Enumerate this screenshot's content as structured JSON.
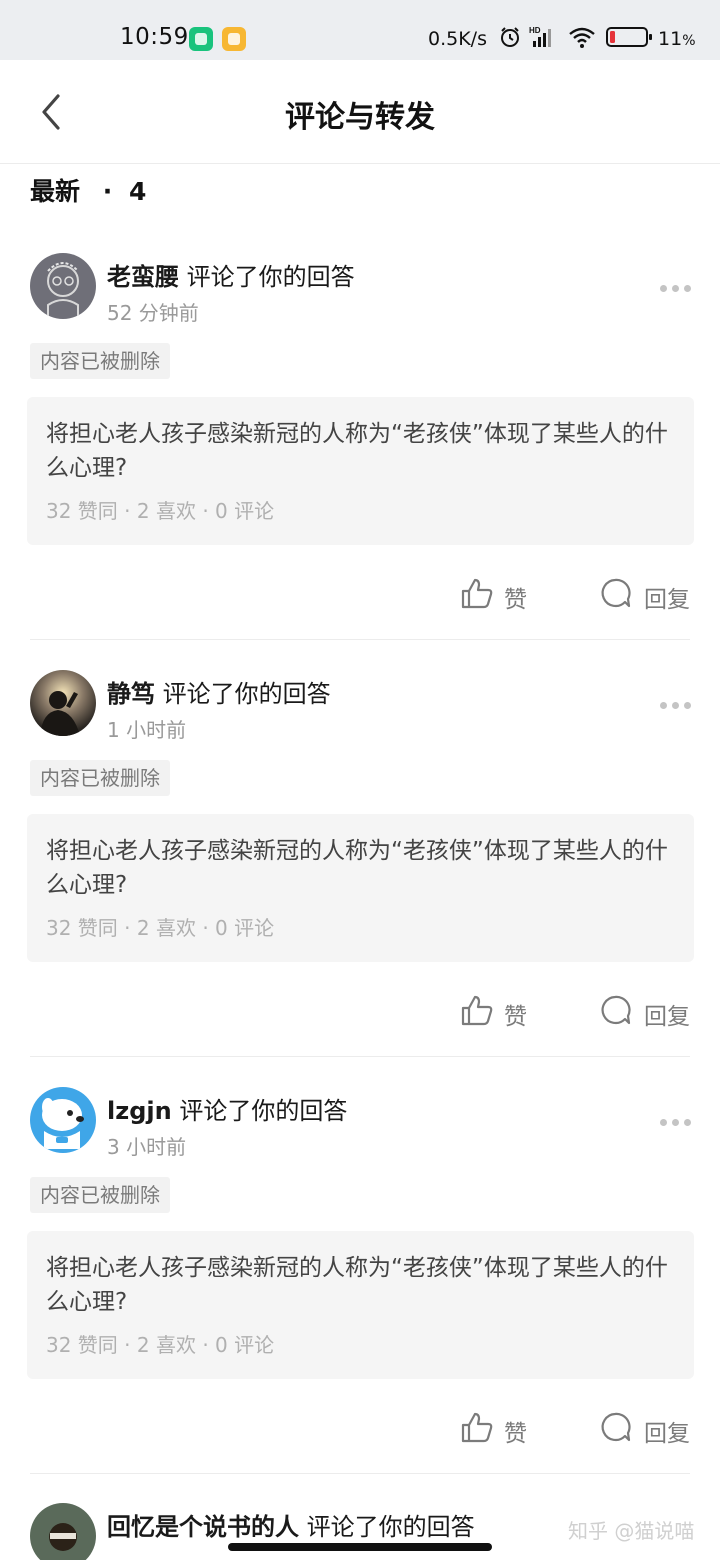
{
  "status_bar": {
    "time": "10:59",
    "network_speed": "0.5K/s",
    "battery": "11",
    "battery_suffix": "%",
    "icons": [
      "shield-app-icon",
      "gallery-app-icon",
      "alarm-icon",
      "hd-signal-icon",
      "wifi-icon",
      "battery-icon"
    ],
    "battery_color": "#e5333a"
  },
  "header": {
    "title": "评论与转发"
  },
  "section": {
    "label": "最新",
    "separator": "·",
    "count": "4"
  },
  "items": [
    {
      "user": "老蛮腰",
      "action": " 评论了你的回答",
      "time": "52 分钟前",
      "tag": "内容已被删除",
      "question": "将担心老人孩子感染新冠的人称为“老孩侠”体现了某些人的什么心理?",
      "stats": "32 赞同  ·  2 喜欢  ·  0 评论",
      "like_label": "赞",
      "reply_label": "回复"
    },
    {
      "user": "静笃",
      "action": " 评论了你的回答",
      "time": "1 小时前",
      "tag": "内容已被删除",
      "question": "将担心老人孩子感染新冠的人称为“老孩侠”体现了某些人的什么心理?",
      "stats": "32 赞同  ·  2 喜欢  ·  0 评论",
      "like_label": "赞",
      "reply_label": "回复"
    },
    {
      "user": "lzgjn",
      "action": " 评论了你的回答",
      "time": "3 小时前",
      "tag": "内容已被删除",
      "question": "将担心老人孩子感染新冠的人称为“老孩侠”体现了某些人的什么心理?",
      "stats": "32 赞同  ·  2 喜欢  ·  0 评论",
      "like_label": "赞",
      "reply_label": "回复"
    },
    {
      "user": "回忆是个说书的人",
      "action": " 评论了你的回答"
    }
  ],
  "watermark": "知乎 @猫说喵",
  "colors": {
    "accent": "#121212",
    "muted": "#9a9a9a",
    "card_bg": "#f5f5f5"
  }
}
